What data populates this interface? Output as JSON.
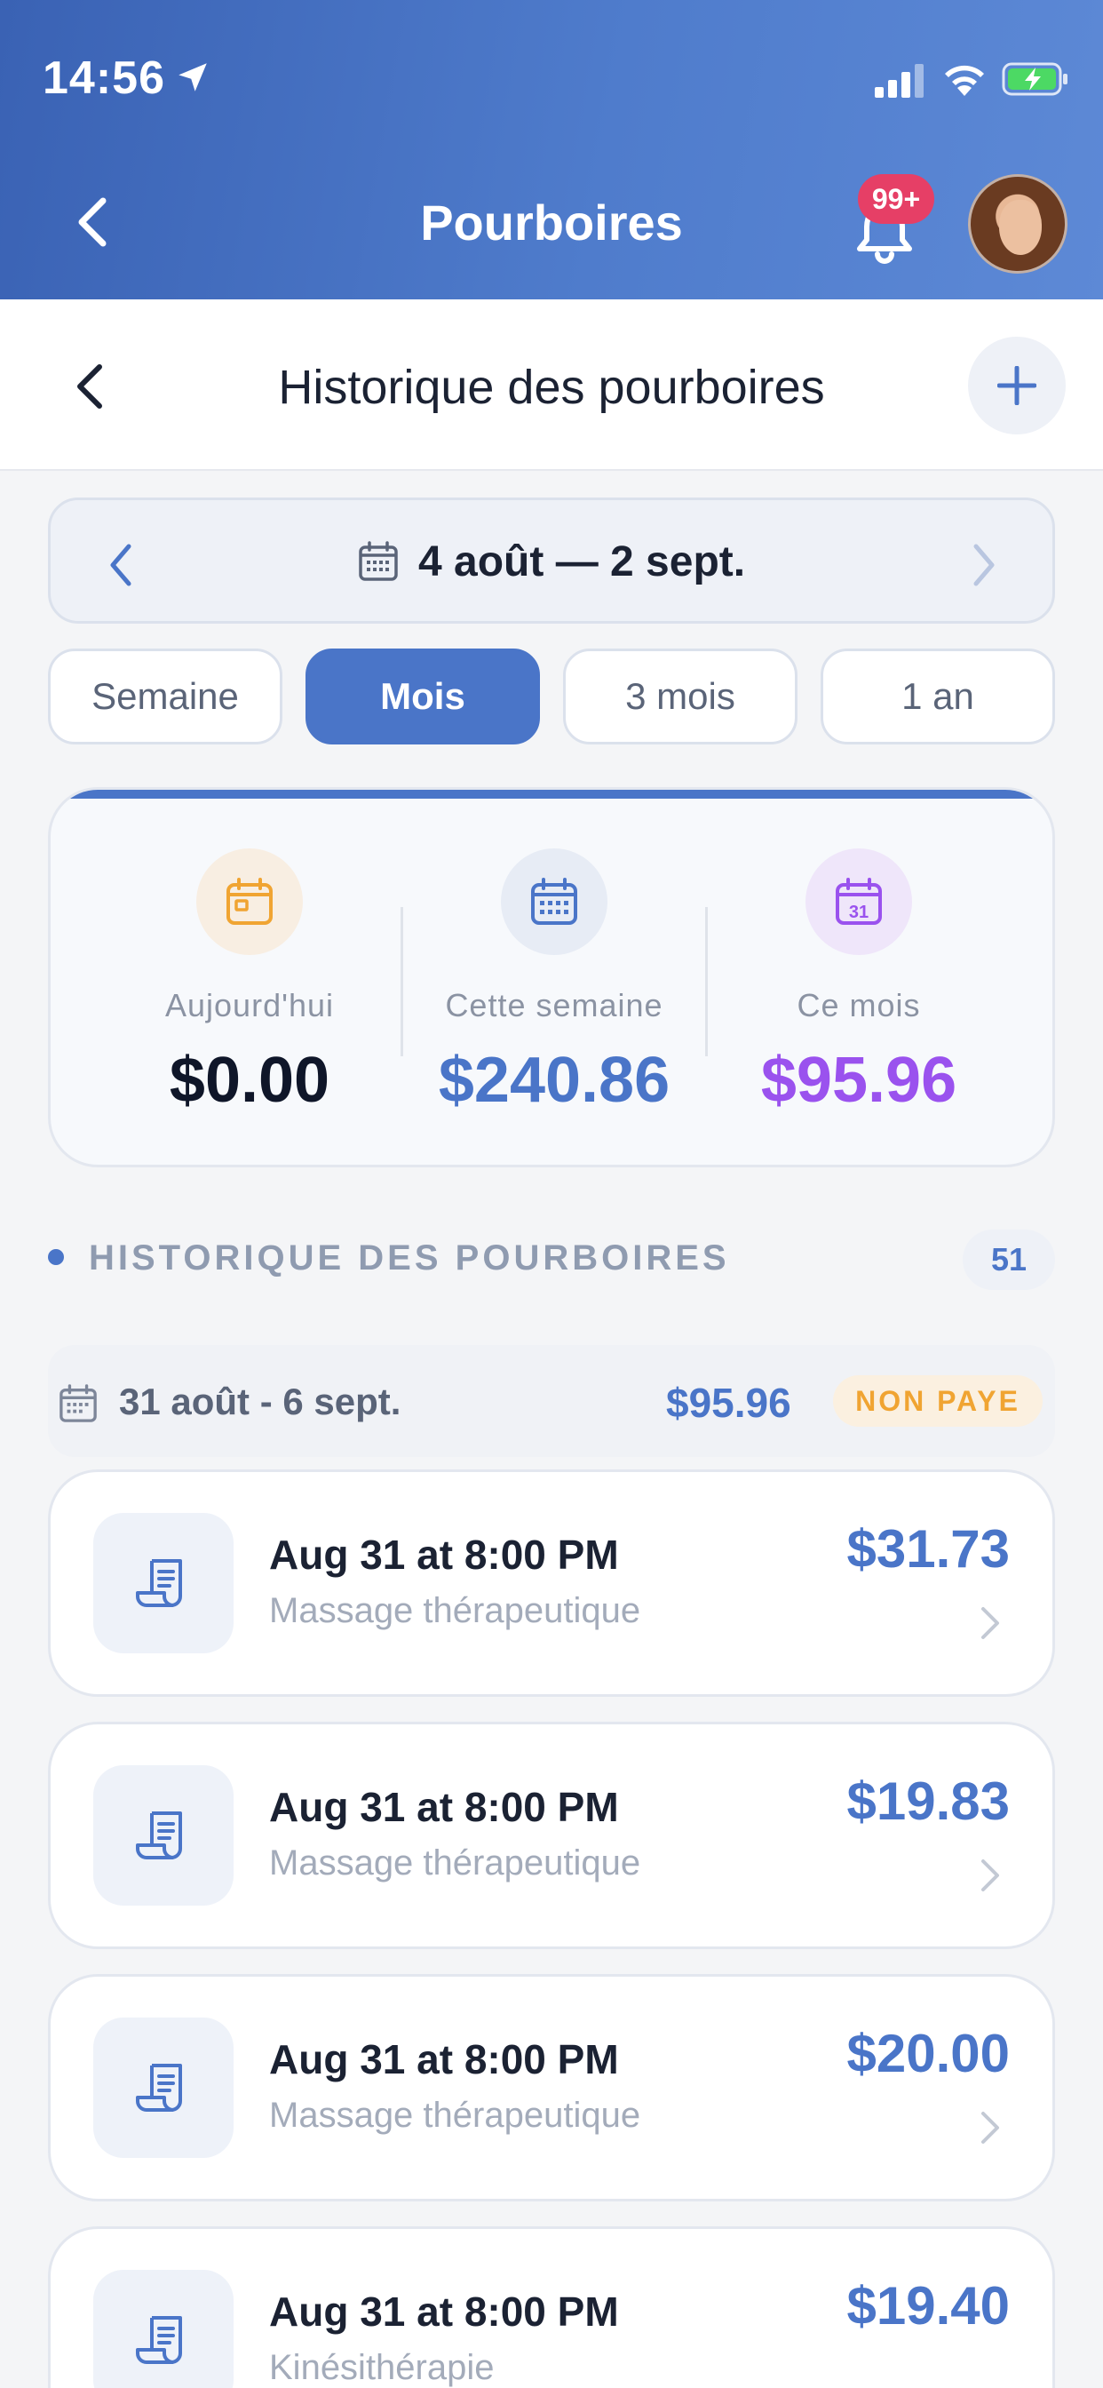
{
  "status_bar": {
    "time": "14:56"
  },
  "header": {
    "title": "Pourboires",
    "notification_badge": "99+"
  },
  "subheader": {
    "title": "Historique des pourboires"
  },
  "date_range": {
    "label": "4 août — 2 sept."
  },
  "period_tabs": [
    {
      "label": "Semaine",
      "active": false
    },
    {
      "label": "Mois",
      "active": true
    },
    {
      "label": "3 mois",
      "active": false
    },
    {
      "label": "1 an",
      "active": false
    }
  ],
  "summary": {
    "today": {
      "label": "Aujourd'hui",
      "value": "$0.00"
    },
    "week": {
      "label": "Cette semaine",
      "value": "$240.86"
    },
    "month": {
      "label": "Ce mois",
      "value": "$95.96",
      "icon_day": "31"
    }
  },
  "history": {
    "section_title": "HISTORIQUE DES POURBOIRES",
    "count": "51",
    "group": {
      "label": "31 août - 6 sept.",
      "total": "$95.96",
      "status": "NON PAYE"
    },
    "items": [
      {
        "when": "Aug 31 at 8:00 PM",
        "service": "Massage thérapeutique",
        "amount": "$31.73"
      },
      {
        "when": "Aug 31 at 8:00 PM",
        "service": "Massage thérapeutique",
        "amount": "$19.83"
      },
      {
        "when": "Aug 31 at 8:00 PM",
        "service": "Massage thérapeutique",
        "amount": "$20.00"
      },
      {
        "when": "Aug 31 at 8:00 PM",
        "service": "Kinésithérapie",
        "amount": "$19.40"
      }
    ]
  },
  "colors": {
    "accent": "#4a75c8",
    "today_value": "#0f1629",
    "week_value": "#4a75c8",
    "month_value": "#9a52ee",
    "unpaid": "#f0a432",
    "badge": "#e63f66"
  }
}
